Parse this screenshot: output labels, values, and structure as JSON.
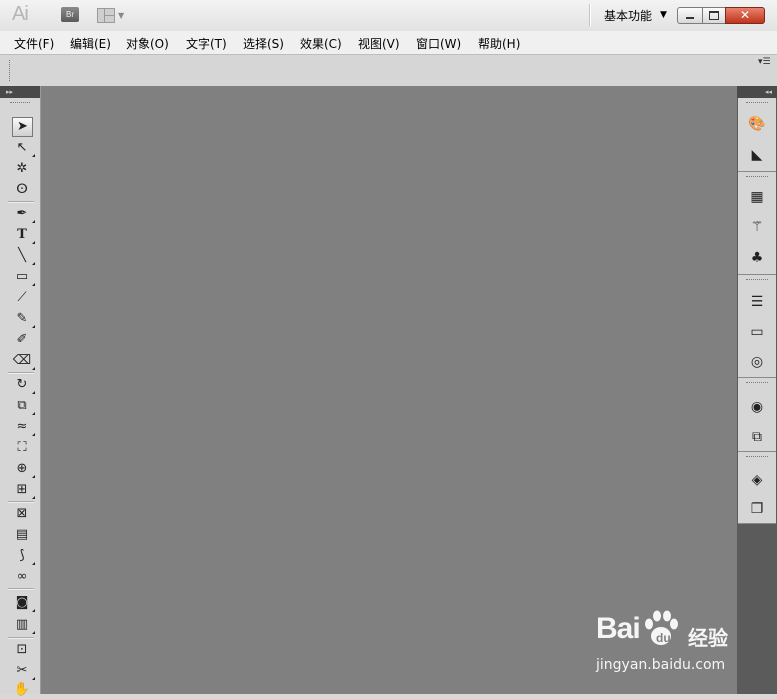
{
  "titlebar": {
    "app_logo": "Ai",
    "bridge_label": "Br",
    "workspace_label": "基本功能"
  },
  "menu": [
    "文件(F)",
    "编辑(E)",
    "对象(O)",
    "文字(T)",
    "选择(S)",
    "效果(C)",
    "视图(V)",
    "窗口(W)",
    "帮助(H)"
  ],
  "tools": [
    {
      "name": "selection-tool-icon",
      "glyph": "➤"
    },
    {
      "name": "direct-selection-tool-icon",
      "glyph": "↖"
    },
    {
      "name": "magic-wand-tool-icon",
      "glyph": "✲"
    },
    {
      "name": "lasso-tool-icon",
      "glyph": "ⵙ"
    },
    {
      "name": "pen-tool-icon",
      "glyph": "✒"
    },
    {
      "name": "type-tool-icon",
      "glyph": "T"
    },
    {
      "name": "line-segment-tool-icon",
      "glyph": "╲"
    },
    {
      "name": "rectangle-tool-icon",
      "glyph": "▭"
    },
    {
      "name": "paintbrush-tool-icon",
      "glyph": "⟋"
    },
    {
      "name": "pencil-tool-icon",
      "glyph": "✎"
    },
    {
      "name": "blob-brush-tool-icon",
      "glyph": "✐"
    },
    {
      "name": "eraser-tool-icon",
      "glyph": "⌫"
    },
    {
      "name": "rotate-tool-icon",
      "glyph": "↻"
    },
    {
      "name": "scale-tool-icon",
      "glyph": "⧉"
    },
    {
      "name": "warp-tool-icon",
      "glyph": "≈"
    },
    {
      "name": "free-transform-tool-icon",
      "glyph": "⛶"
    },
    {
      "name": "shape-builder-tool-icon",
      "glyph": "⊕"
    },
    {
      "name": "perspective-grid-tool-icon",
      "glyph": "⊞"
    },
    {
      "name": "mesh-tool-icon",
      "glyph": "⊠"
    },
    {
      "name": "gradient-tool-icon",
      "glyph": "▤"
    },
    {
      "name": "eyedropper-tool-icon",
      "glyph": "⟆"
    },
    {
      "name": "blend-tool-icon",
      "glyph": "∞"
    },
    {
      "name": "symbol-sprayer-tool-icon",
      "glyph": "◙"
    },
    {
      "name": "column-graph-tool-icon",
      "glyph": "▥"
    },
    {
      "name": "artboard-tool-icon",
      "glyph": "⊡"
    },
    {
      "name": "slice-tool-icon",
      "glyph": "✂"
    },
    {
      "name": "hand-tool-icon",
      "glyph": "✋"
    }
  ],
  "dock_icons": [
    {
      "name": "color-panel-icon",
      "glyph": "🎨"
    },
    {
      "name": "color-guide-panel-icon",
      "glyph": "◣"
    },
    {
      "name": "swatches-panel-icon",
      "glyph": "▦"
    },
    {
      "name": "brushes-panel-icon",
      "glyph": "⚚"
    },
    {
      "name": "symbols-panel-icon",
      "glyph": "♣"
    },
    {
      "name": "stroke-panel-icon",
      "glyph": "☰"
    },
    {
      "name": "gradient-panel-icon",
      "glyph": "▭"
    },
    {
      "name": "transparency-panel-icon",
      "glyph": "◎"
    },
    {
      "name": "appearance-panel-icon",
      "glyph": "◉"
    },
    {
      "name": "graphic-styles-panel-icon",
      "glyph": "⧉"
    },
    {
      "name": "layers-panel-icon",
      "glyph": "◈"
    },
    {
      "name": "artboards-panel-icon",
      "glyph": "❐"
    }
  ],
  "watermark": {
    "logo": "Bai",
    "logo_suffix": "经验",
    "url": "jingyan.baidu.com"
  }
}
